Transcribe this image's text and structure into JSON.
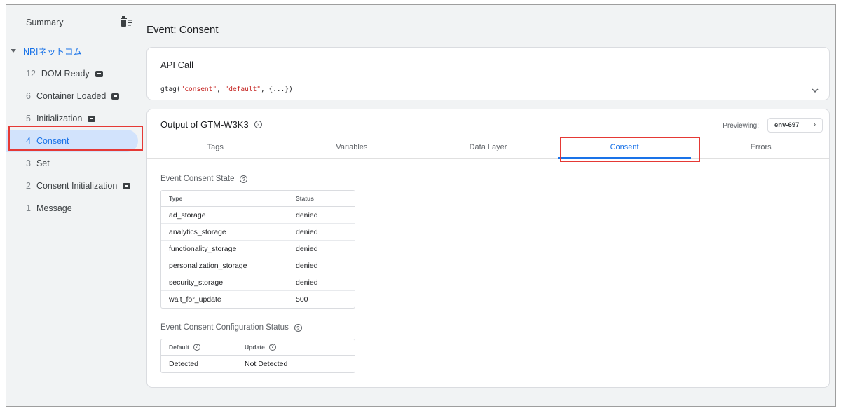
{
  "sidebar": {
    "summary_label": "Summary",
    "container_name": "NRIネットコム",
    "events": [
      {
        "num": "12",
        "label": "DOM Ready",
        "badge": true
      },
      {
        "num": "6",
        "label": "Container Loaded",
        "badge": true
      },
      {
        "num": "5",
        "label": "Initialization",
        "badge": true
      },
      {
        "num": "4",
        "label": "Consent",
        "badge": false,
        "selected": true
      },
      {
        "num": "3",
        "label": "Set",
        "badge": false
      },
      {
        "num": "2",
        "label": "Consent Initialization",
        "badge": true
      },
      {
        "num": "1",
        "label": "Message",
        "badge": false
      }
    ]
  },
  "main": {
    "page_title": "Event: Consent",
    "api_call": {
      "title": "API Call",
      "code_prefix": "gtag(",
      "code_arg1": "\"consent\"",
      "code_sep": ", ",
      "code_arg2": "\"default\"",
      "code_suffix": ", {...})"
    },
    "output": {
      "title": "Output of GTM-W3K3",
      "previewing_label": "Previewing:",
      "env_label": "env-697",
      "tabs": [
        "Tags",
        "Variables",
        "Data Layer",
        "Consent",
        "Errors"
      ],
      "active_tab": "Consent",
      "consent_state": {
        "title": "Event Consent State",
        "headers": [
          "Type",
          "Status"
        ],
        "rows": [
          {
            "type": "ad_storage",
            "status": "denied"
          },
          {
            "type": "analytics_storage",
            "status": "denied"
          },
          {
            "type": "functionality_storage",
            "status": "denied"
          },
          {
            "type": "personalization_storage",
            "status": "denied"
          },
          {
            "type": "security_storage",
            "status": "denied"
          },
          {
            "type": "wait_for_update",
            "status": "500"
          }
        ]
      },
      "config_status": {
        "title": "Event Consent Configuration Status",
        "headers": [
          "Default",
          "Update"
        ],
        "rows": [
          {
            "default": "Detected",
            "update": "Not Detected"
          }
        ]
      }
    }
  },
  "colors": {
    "accent": "#1a73e8",
    "highlight": "#e53935",
    "selected_bg": "#d2e3fc",
    "code_string": "#c5221f"
  },
  "icons": [
    "trash-icon",
    "expand-triangle-icon",
    "tag-badge-icon",
    "help-icon",
    "chevron-down-icon",
    "chevron-right-icon"
  ]
}
